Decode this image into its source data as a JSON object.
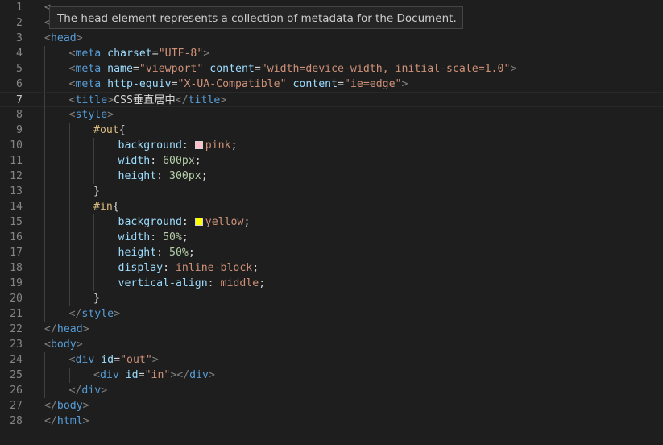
{
  "tooltip": {
    "text": "The head element represents a collection of metadata for the Document."
  },
  "colors": {
    "pink": "#ffc0cb",
    "yellow": "#ffff00"
  },
  "active_line": 7,
  "lines": [
    {
      "n": "1",
      "indent": 0,
      "tokens": [
        {
          "t": "bracket",
          "v": "<"
        }
      ]
    },
    {
      "n": "2",
      "indent": 0,
      "tokens": [
        {
          "t": "bracket",
          "v": "<"
        }
      ]
    },
    {
      "n": "3",
      "indent": 0,
      "tokens": [
        {
          "t": "bracket",
          "v": "<"
        },
        {
          "t": "tag",
          "v": "head"
        },
        {
          "t": "bracket",
          "v": ">"
        }
      ]
    },
    {
      "n": "4",
      "indent": 1,
      "tokens": [
        {
          "t": "bracket",
          "v": "<"
        },
        {
          "t": "tag",
          "v": "meta"
        },
        {
          "t": "text",
          "v": " "
        },
        {
          "t": "attr",
          "v": "charset"
        },
        {
          "t": "text",
          "v": "="
        },
        {
          "t": "str",
          "v": "\"UTF-8\""
        },
        {
          "t": "bracket",
          "v": ">"
        }
      ]
    },
    {
      "n": "5",
      "indent": 1,
      "tokens": [
        {
          "t": "bracket",
          "v": "<"
        },
        {
          "t": "tag",
          "v": "meta"
        },
        {
          "t": "text",
          "v": " "
        },
        {
          "t": "attr",
          "v": "name"
        },
        {
          "t": "text",
          "v": "="
        },
        {
          "t": "str",
          "v": "\"viewport\""
        },
        {
          "t": "text",
          "v": " "
        },
        {
          "t": "attr",
          "v": "content"
        },
        {
          "t": "text",
          "v": "="
        },
        {
          "t": "str",
          "v": "\"width=device-width, initial-scale=1.0\""
        },
        {
          "t": "bracket",
          "v": ">"
        }
      ]
    },
    {
      "n": "6",
      "indent": 1,
      "tokens": [
        {
          "t": "bracket",
          "v": "<"
        },
        {
          "t": "tag",
          "v": "meta"
        },
        {
          "t": "text",
          "v": " "
        },
        {
          "t": "attr",
          "v": "http-equiv"
        },
        {
          "t": "text",
          "v": "="
        },
        {
          "t": "str",
          "v": "\"X-UA-Compatible\""
        },
        {
          "t": "text",
          "v": " "
        },
        {
          "t": "attr",
          "v": "content"
        },
        {
          "t": "text",
          "v": "="
        },
        {
          "t": "str",
          "v": "\"ie=edge\""
        },
        {
          "t": "bracket",
          "v": ">"
        }
      ]
    },
    {
      "n": "7",
      "indent": 1,
      "tokens": [
        {
          "t": "bracket",
          "v": "<"
        },
        {
          "t": "tag",
          "v": "title"
        },
        {
          "t": "bracket",
          "v": ">"
        },
        {
          "t": "text",
          "v": "CSS垂直居中"
        },
        {
          "t": "bracket",
          "v": "</"
        },
        {
          "t": "tag",
          "v": "title"
        },
        {
          "t": "bracket",
          "v": ">"
        }
      ]
    },
    {
      "n": "8",
      "indent": 1,
      "tokens": [
        {
          "t": "bracket",
          "v": "<"
        },
        {
          "t": "tag",
          "v": "style"
        },
        {
          "t": "bracket",
          "v": ">"
        }
      ]
    },
    {
      "n": "9",
      "indent": 2,
      "tokens": [
        {
          "t": "sel",
          "v": "#out"
        },
        {
          "t": "punc",
          "v": "{"
        }
      ]
    },
    {
      "n": "10",
      "indent": 3,
      "tokens": [
        {
          "t": "prop",
          "v": "background"
        },
        {
          "t": "punc",
          "v": ": "
        },
        {
          "t": "swatch",
          "v": "pink"
        },
        {
          "t": "val",
          "v": "pink"
        },
        {
          "t": "punc",
          "v": ";"
        }
      ]
    },
    {
      "n": "11",
      "indent": 3,
      "tokens": [
        {
          "t": "prop",
          "v": "width"
        },
        {
          "t": "punc",
          "v": ": "
        },
        {
          "t": "num",
          "v": "600px"
        },
        {
          "t": "punc",
          "v": ";"
        }
      ]
    },
    {
      "n": "12",
      "indent": 3,
      "tokens": [
        {
          "t": "prop",
          "v": "height"
        },
        {
          "t": "punc",
          "v": ": "
        },
        {
          "t": "num",
          "v": "300px"
        },
        {
          "t": "punc",
          "v": ";"
        }
      ]
    },
    {
      "n": "13",
      "indent": 2,
      "tokens": [
        {
          "t": "punc",
          "v": "}"
        }
      ]
    },
    {
      "n": "14",
      "indent": 2,
      "tokens": [
        {
          "t": "sel",
          "v": "#in"
        },
        {
          "t": "punc",
          "v": "{"
        }
      ]
    },
    {
      "n": "15",
      "indent": 3,
      "tokens": [
        {
          "t": "prop",
          "v": "background"
        },
        {
          "t": "punc",
          "v": ": "
        },
        {
          "t": "swatch",
          "v": "yellow"
        },
        {
          "t": "val",
          "v": "yellow"
        },
        {
          "t": "punc",
          "v": ";"
        }
      ]
    },
    {
      "n": "16",
      "indent": 3,
      "tokens": [
        {
          "t": "prop",
          "v": "width"
        },
        {
          "t": "punc",
          "v": ": "
        },
        {
          "t": "num",
          "v": "50%"
        },
        {
          "t": "punc",
          "v": ";"
        }
      ]
    },
    {
      "n": "17",
      "indent": 3,
      "tokens": [
        {
          "t": "prop",
          "v": "height"
        },
        {
          "t": "punc",
          "v": ": "
        },
        {
          "t": "num",
          "v": "50%"
        },
        {
          "t": "punc",
          "v": ";"
        }
      ]
    },
    {
      "n": "18",
      "indent": 3,
      "tokens": [
        {
          "t": "prop",
          "v": "display"
        },
        {
          "t": "punc",
          "v": ": "
        },
        {
          "t": "val",
          "v": "inline-block"
        },
        {
          "t": "punc",
          "v": ";"
        }
      ]
    },
    {
      "n": "19",
      "indent": 3,
      "tokens": [
        {
          "t": "prop",
          "v": "vertical-align"
        },
        {
          "t": "punc",
          "v": ": "
        },
        {
          "t": "val",
          "v": "middle"
        },
        {
          "t": "punc",
          "v": ";"
        }
      ]
    },
    {
      "n": "20",
      "indent": 2,
      "tokens": [
        {
          "t": "punc",
          "v": "}"
        }
      ]
    },
    {
      "n": "21",
      "indent": 1,
      "tokens": [
        {
          "t": "bracket",
          "v": "</"
        },
        {
          "t": "tag",
          "v": "style"
        },
        {
          "t": "bracket",
          "v": ">"
        }
      ]
    },
    {
      "n": "22",
      "indent": 0,
      "tokens": [
        {
          "t": "bracket",
          "v": "</"
        },
        {
          "t": "tag",
          "v": "head"
        },
        {
          "t": "bracket",
          "v": ">"
        }
      ]
    },
    {
      "n": "23",
      "indent": 0,
      "tokens": [
        {
          "t": "bracket",
          "v": "<"
        },
        {
          "t": "tag",
          "v": "body"
        },
        {
          "t": "bracket",
          "v": ">"
        }
      ]
    },
    {
      "n": "24",
      "indent": 1,
      "tokens": [
        {
          "t": "bracket",
          "v": "<"
        },
        {
          "t": "tag",
          "v": "div"
        },
        {
          "t": "text",
          "v": " "
        },
        {
          "t": "attr",
          "v": "id"
        },
        {
          "t": "text",
          "v": "="
        },
        {
          "t": "str",
          "v": "\"out\""
        },
        {
          "t": "bracket",
          "v": ">"
        }
      ]
    },
    {
      "n": "25",
      "indent": 2,
      "tokens": [
        {
          "t": "bracket",
          "v": "<"
        },
        {
          "t": "tag",
          "v": "div"
        },
        {
          "t": "text",
          "v": " "
        },
        {
          "t": "attr",
          "v": "id"
        },
        {
          "t": "text",
          "v": "="
        },
        {
          "t": "str",
          "v": "\"in\""
        },
        {
          "t": "bracket",
          "v": "></"
        },
        {
          "t": "tag",
          "v": "div"
        },
        {
          "t": "bracket",
          "v": ">"
        }
      ]
    },
    {
      "n": "26",
      "indent": 1,
      "tokens": [
        {
          "t": "bracket",
          "v": "</"
        },
        {
          "t": "tag",
          "v": "div"
        },
        {
          "t": "bracket",
          "v": ">"
        }
      ]
    },
    {
      "n": "27",
      "indent": 0,
      "tokens": [
        {
          "t": "bracket",
          "v": "</"
        },
        {
          "t": "tag",
          "v": "body"
        },
        {
          "t": "bracket",
          "v": ">"
        }
      ]
    },
    {
      "n": "28",
      "indent": 0,
      "tokens": [
        {
          "t": "bracket",
          "v": "</"
        },
        {
          "t": "tag",
          "v": "html"
        },
        {
          "t": "bracket",
          "v": ">"
        }
      ]
    }
  ]
}
